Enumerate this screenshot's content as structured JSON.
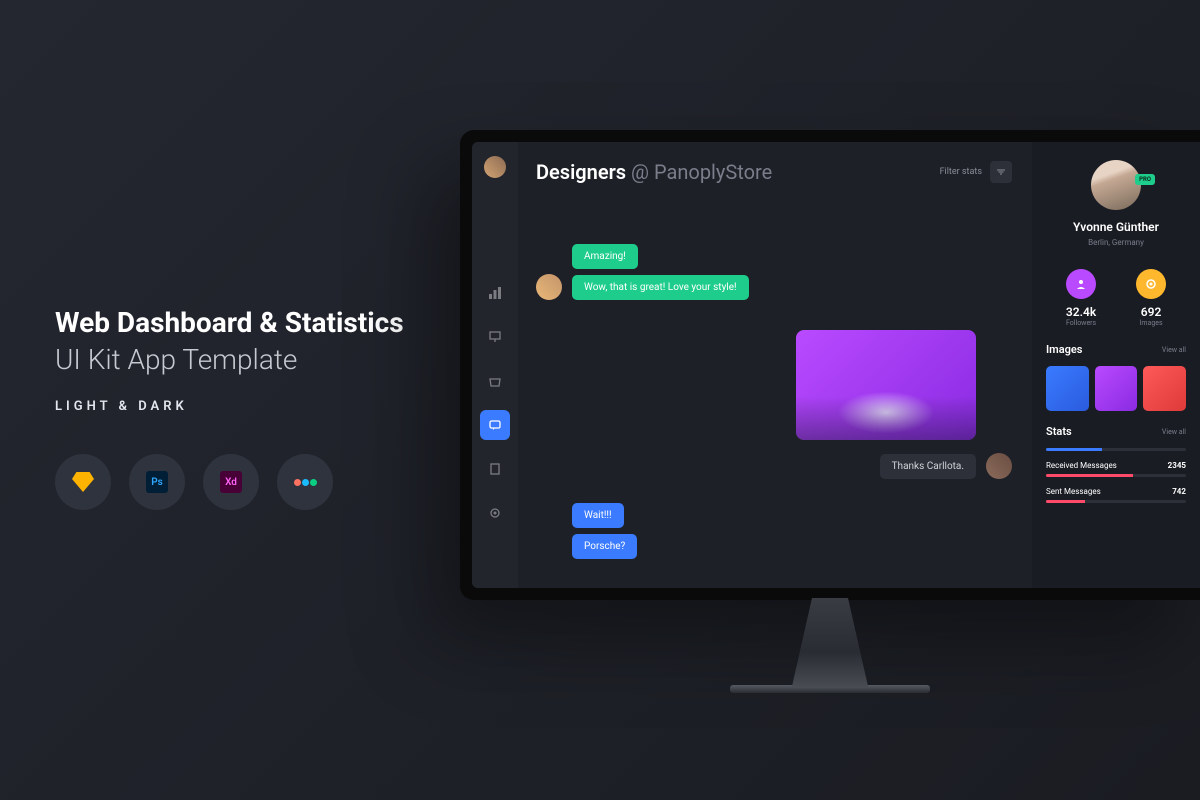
{
  "promo": {
    "title_line1": "Web Dashboard & Statistics",
    "title_line2": "UI Kit App Template",
    "theme_label": "LIGHT & DARK",
    "tools": {
      "ps": "Ps",
      "xd": "Xd"
    }
  },
  "app": {
    "header": {
      "team_label": "Designers",
      "org_prefix": "@",
      "org_name": "PanoplyStore",
      "filter_label": "Filter stats"
    },
    "chat": {
      "messages": [
        {
          "text": "Amazing!"
        },
        {
          "text": "Wow, that is great! Love your style!"
        }
      ],
      "reply": {
        "text": "Thanks Carllota."
      },
      "followup": [
        {
          "text": "Wait!!!"
        },
        {
          "text": "Porsche?"
        }
      ]
    },
    "profile": {
      "name": "Yvonne Günther",
      "location": "Berlin, Germany",
      "pro_badge": "PRO",
      "stats": [
        {
          "value": "32.4k",
          "label": "Followers"
        },
        {
          "value": "692",
          "label": "Images"
        }
      ]
    },
    "images_section": {
      "title": "Images",
      "view_all": "View all"
    },
    "stats_section": {
      "title": "Stats",
      "view_all": "View all",
      "rows": [
        {
          "label": "Received Messages",
          "value": "2345",
          "pct": 62
        },
        {
          "label": "Sent Messages",
          "value": "742",
          "pct": 28
        }
      ]
    }
  }
}
